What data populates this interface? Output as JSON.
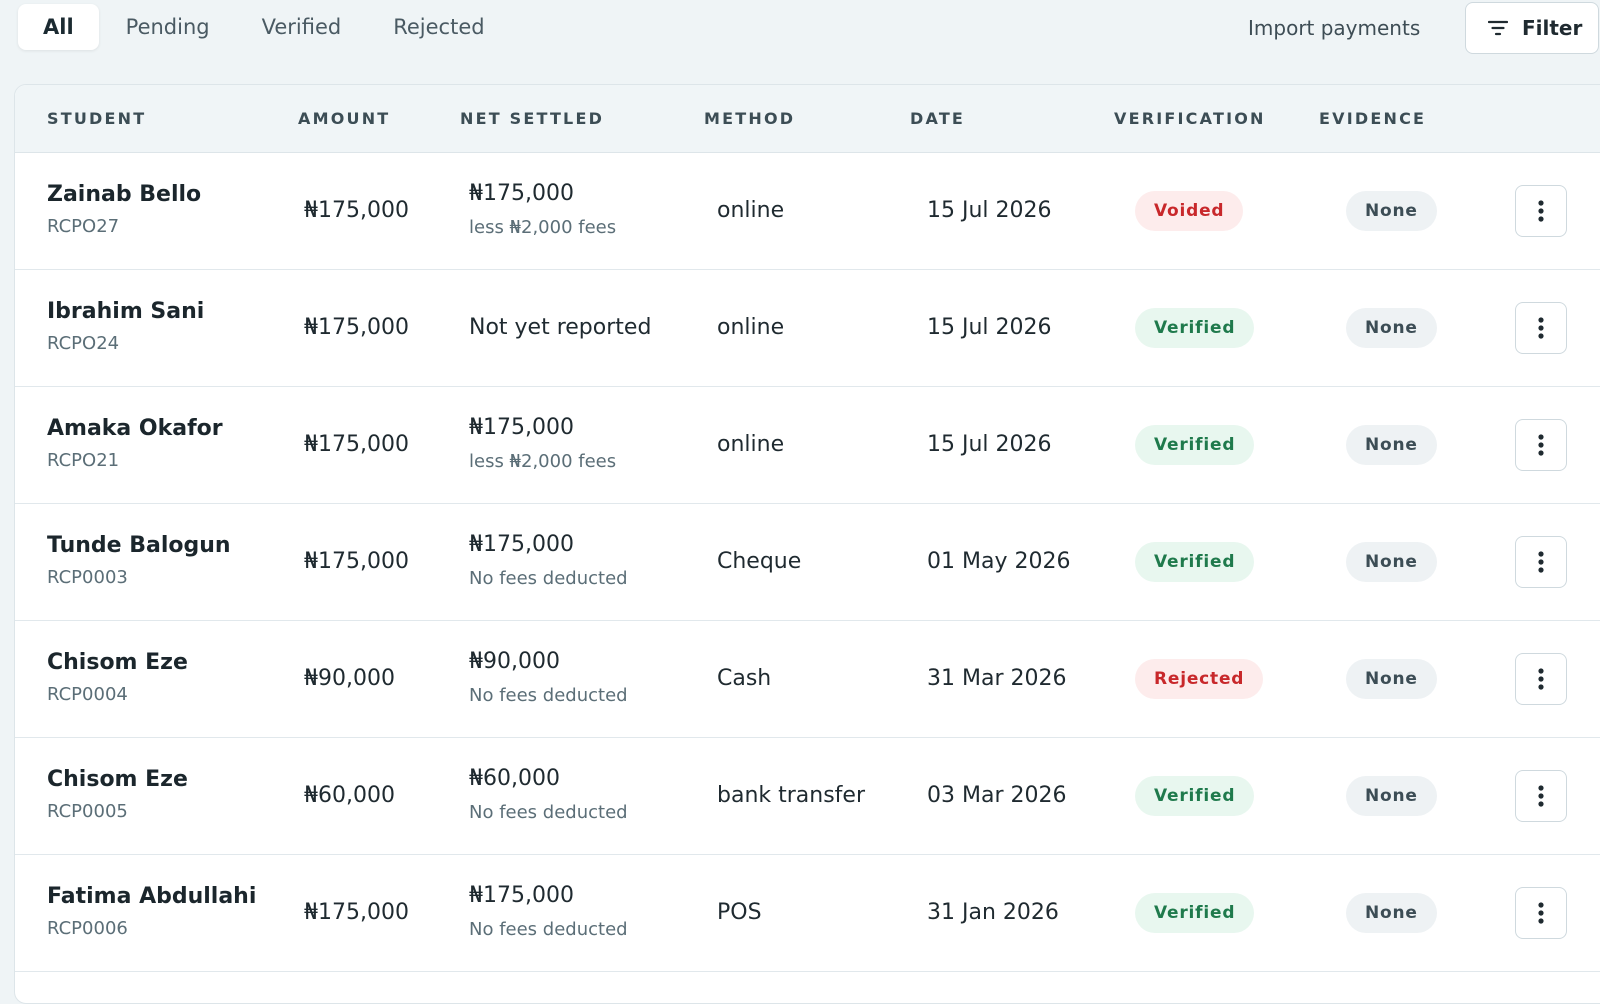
{
  "tabs": [
    {
      "label": "All",
      "active": true
    },
    {
      "label": "Pending",
      "active": false
    },
    {
      "label": "Verified",
      "active": false
    },
    {
      "label": "Rejected",
      "active": false
    }
  ],
  "toolbar": {
    "import_label": "Import payments",
    "filter_label": "Filter"
  },
  "columns": [
    "STUDENT",
    "AMOUNT",
    "NET SETTLED",
    "METHOD",
    "DATE",
    "VERIFICATION",
    "EVIDENCE"
  ],
  "status_colors": {
    "Voided": {
      "bg": "#fdecec",
      "fg": "#c8282b"
    },
    "Rejected": {
      "bg": "#fdecec",
      "fg": "#c8282b"
    },
    "Verified": {
      "bg": "#e8f7ef",
      "fg": "#1f7a4c"
    }
  },
  "rows": [
    {
      "name": "Zainab Bello",
      "code": "RCPO27",
      "amount": "₦175,000",
      "net": "₦175,000",
      "net_note": "less ₦2,000 fees",
      "method": "online",
      "date": "15 Jul 2026",
      "verification": "Voided",
      "evidence": "None"
    },
    {
      "name": "Ibrahim Sani",
      "code": "RCPO24",
      "amount": "₦175,000",
      "net": "Not yet reported",
      "net_note": "",
      "method": "online",
      "date": "15 Jul 2026",
      "verification": "Verified",
      "evidence": "None"
    },
    {
      "name": "Amaka Okafor",
      "code": "RCPO21",
      "amount": "₦175,000",
      "net": "₦175,000",
      "net_note": "less ₦2,000 fees",
      "method": "online",
      "date": "15 Jul 2026",
      "verification": "Verified",
      "evidence": "None"
    },
    {
      "name": "Tunde Balogun",
      "code": "RCP0003",
      "amount": "₦175,000",
      "net": "₦175,000",
      "net_note": "No fees deducted",
      "method": "Cheque",
      "date": "01 May 2026",
      "verification": "Verified",
      "evidence": "None"
    },
    {
      "name": "Chisom Eze",
      "code": "RCP0004",
      "amount": "₦90,000",
      "net": "₦90,000",
      "net_note": "No fees deducted",
      "method": "Cash",
      "date": "31 Mar 2026",
      "verification": "Rejected",
      "evidence": "None"
    },
    {
      "name": "Chisom Eze",
      "code": "RCP0005",
      "amount": "₦60,000",
      "net": "₦60,000",
      "net_note": "No fees deducted",
      "method": "bank transfer",
      "date": "03 Mar 2026",
      "verification": "Verified",
      "evidence": "None"
    },
    {
      "name": "Fatima Abdullahi",
      "code": "RCP0006",
      "amount": "₦175,000",
      "net": "₦175,000",
      "net_note": "No fees deducted",
      "method": "POS",
      "date": "31 Jan 2026",
      "verification": "Verified",
      "evidence": "None"
    }
  ],
  "icons": {
    "filter": "filter-lines-icon",
    "row_menu": "more-vertical-icon"
  }
}
